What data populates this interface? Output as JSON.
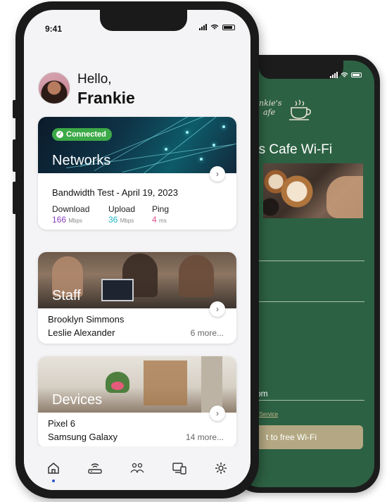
{
  "cafe": {
    "logo_line1": "nkie's",
    "logo_line2": "afe",
    "title": "'s Cafe Wi-Fi",
    "field_value": "om",
    "tos_link": "f Service",
    "connect_button": "t to free Wi-Fi"
  },
  "status": {
    "time": "9:41"
  },
  "greeting": {
    "hello": "Hello,",
    "name": "Frankie"
  },
  "networks": {
    "badge": "Connected",
    "title": "Networks",
    "bandwidth_title": "Bandwidth Test - April 19, 2023",
    "metrics": [
      {
        "label": "Download",
        "value": "166",
        "unit": "Mbps",
        "color": "#8a3fbf"
      },
      {
        "label": "Upload",
        "value": "36",
        "unit": "Mbps",
        "color": "#1fb6c8"
      },
      {
        "label": "Ping",
        "value": "4",
        "unit": "ms",
        "color": "#e0508a"
      }
    ]
  },
  "staff": {
    "title": "Staff",
    "members": [
      "Brooklyn Simmons",
      "Leslie Alexander"
    ],
    "more": "6 more..."
  },
  "devices": {
    "title": "Devices",
    "items": [
      "Pixel 6",
      "Samsung Galaxy"
    ],
    "more": "14 more..."
  },
  "tabs": [
    {
      "icon": "home-icon",
      "active": true
    },
    {
      "icon": "router-icon",
      "active": false
    },
    {
      "icon": "people-icon",
      "active": false
    },
    {
      "icon": "devices-icon",
      "active": false
    },
    {
      "icon": "settings-icon",
      "active": false
    }
  ],
  "colors": {
    "cafe_green": "#2d6143",
    "connected_green": "#3daa48",
    "active_tab_dot": "#2b57c7"
  }
}
